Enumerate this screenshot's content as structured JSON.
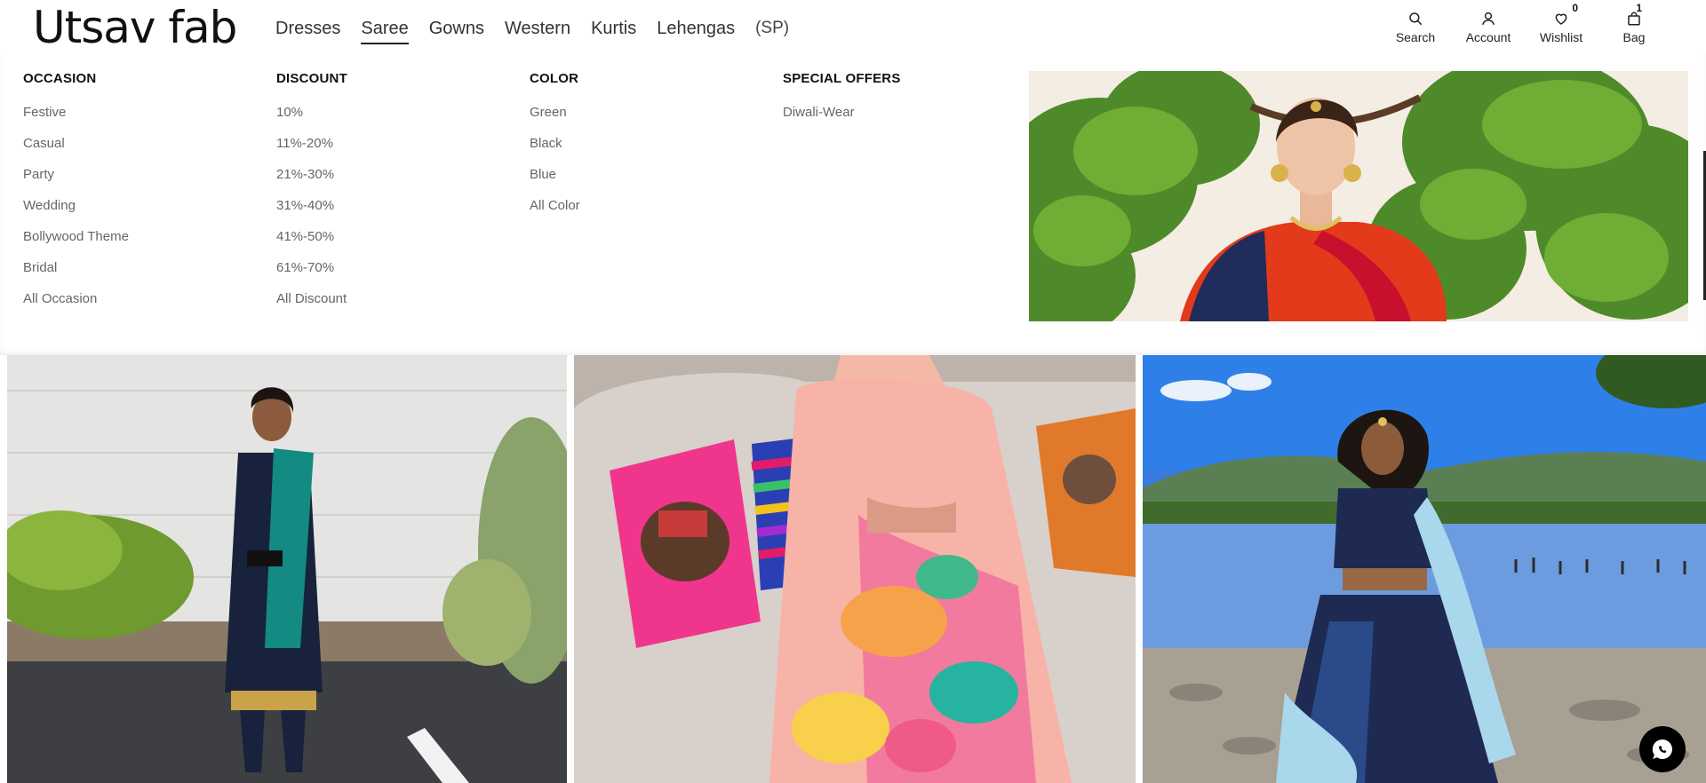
{
  "brand": {
    "logo_text": "Utsav fab"
  },
  "nav": {
    "items": [
      {
        "label": "Dresses",
        "active": false
      },
      {
        "label": "Saree",
        "active": true
      },
      {
        "label": "Gowns",
        "active": false
      },
      {
        "label": "Western",
        "active": false
      },
      {
        "label": "Kurtis",
        "active": false
      },
      {
        "label": "Lehengas",
        "active": false
      },
      {
        "label": "(SP)",
        "active": false
      }
    ]
  },
  "tools": {
    "search": {
      "label": "Search",
      "icon": "search-icon"
    },
    "account": {
      "label": "Account",
      "icon": "user-icon"
    },
    "wishlist": {
      "label": "Wishlist",
      "icon": "heart-icon",
      "count": "0"
    },
    "bag": {
      "label": "Bag",
      "icon": "bag-icon",
      "count": "1"
    }
  },
  "mega_menu": {
    "columns": [
      {
        "title": "OCCASION",
        "items": [
          "Festive",
          "Casual",
          "Party",
          "Wedding",
          "Bollywood Theme",
          "Bridal",
          "All Occasion"
        ]
      },
      {
        "title": "DISCOUNT",
        "items": [
          "10%",
          "11%-20%",
          "21%-30%",
          "31%-40%",
          "41%-50%",
          "61%-70%",
          "All Discount"
        ]
      },
      {
        "title": "COLOR",
        "items": [
          "Green",
          "Black",
          "Blue",
          "All Color"
        ]
      },
      {
        "title": "SPECIAL OFFERS",
        "items": [
          "Diwali-Wear"
        ]
      }
    ]
  },
  "colors": {
    "text_primary": "#111111",
    "text_secondary": "#666666",
    "chat_button": "#000000"
  }
}
